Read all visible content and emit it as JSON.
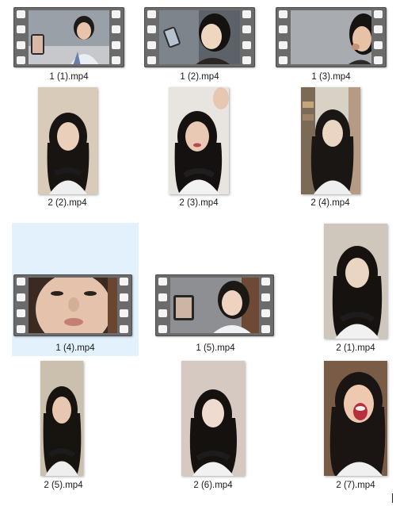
{
  "files": [
    {
      "name": "1 (1).mp4",
      "kind": "film",
      "selected": false,
      "icon": "video-file-icon"
    },
    {
      "name": "1 (2).mp4",
      "kind": "film",
      "selected": false,
      "icon": "video-file-icon"
    },
    {
      "name": "1 (3).mp4",
      "kind": "film",
      "selected": false,
      "icon": "video-file-icon"
    },
    {
      "name": "2 (2).mp4",
      "kind": "portrait",
      "selected": false
    },
    {
      "name": "2 (3).mp4",
      "kind": "portrait",
      "selected": false
    },
    {
      "name": "2 (4).mp4",
      "kind": "portrait",
      "selected": false
    },
    {
      "name": "1 (4).mp4",
      "kind": "film",
      "selected": true,
      "icon": "video-file-icon"
    },
    {
      "name": "1 (5).mp4",
      "kind": "film",
      "selected": false,
      "icon": "video-file-icon"
    },
    {
      "name": "2 (1).mp4",
      "kind": "portrait",
      "selected": false
    },
    {
      "name": "2 (5).mp4",
      "kind": "portrait",
      "selected": false
    },
    {
      "name": "2 (6).mp4",
      "kind": "portrait",
      "selected": false
    },
    {
      "name": "2 (7).mp4",
      "kind": "portrait",
      "selected": false
    }
  ],
  "colors": {
    "selection": "#e3f1fd",
    "film": "#6b6b6b"
  }
}
